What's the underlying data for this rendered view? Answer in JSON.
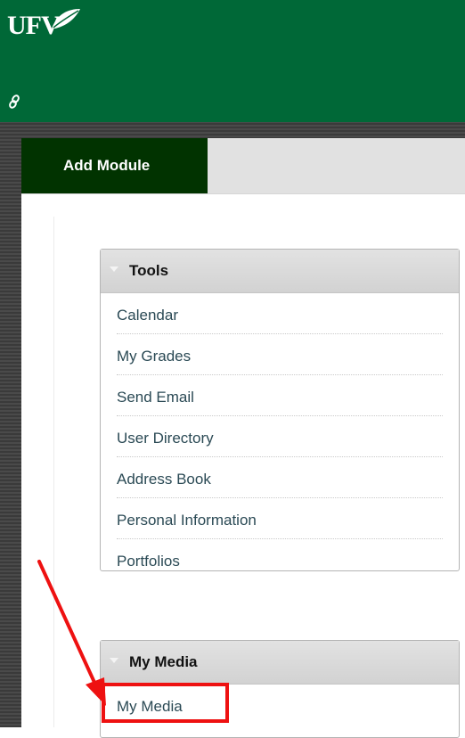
{
  "header": {
    "logo_text": "UFV",
    "brand_color": "#006837",
    "link_icon": "link-icon"
  },
  "tabbar": {
    "add_module_label": "Add Module",
    "active_color": "#013300"
  },
  "modules": [
    {
      "title": "Tools",
      "items": [
        "Calendar",
        "My Grades",
        "Send Email",
        "User Directory",
        "Address Book",
        "Personal Information",
        "Portfolios"
      ]
    },
    {
      "title": "My Media",
      "items": [
        "My Media"
      ]
    }
  ],
  "annotation": {
    "color": "#ee1111",
    "target": "My Media"
  }
}
